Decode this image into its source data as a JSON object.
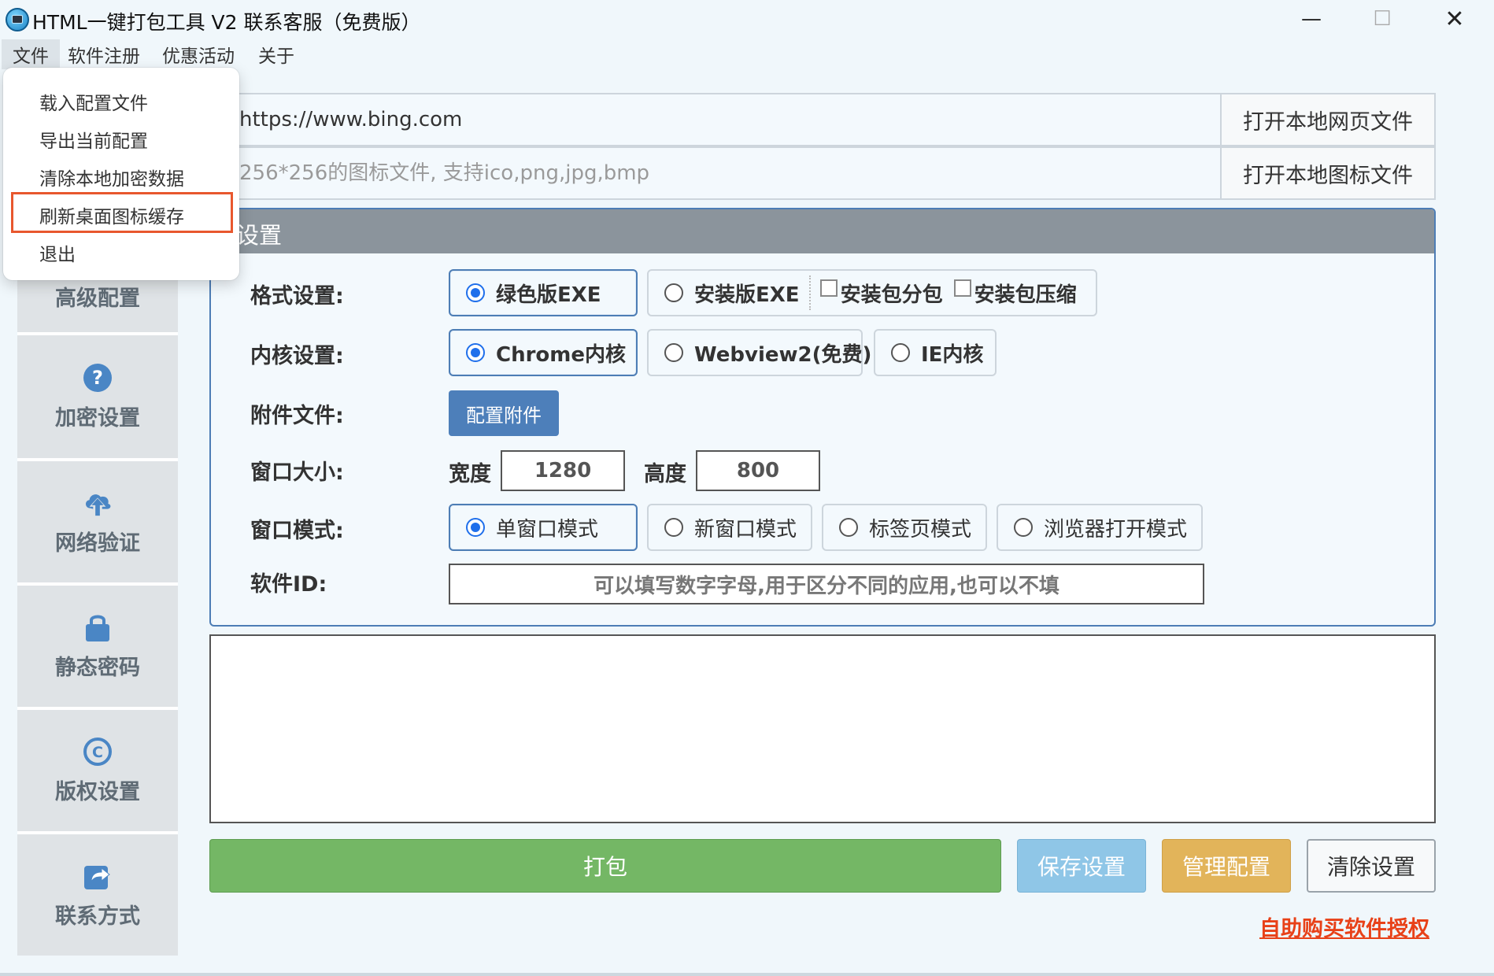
{
  "window": {
    "title": "HTML一键打包工具 V2 联系客服（免费版）",
    "minimize": "—",
    "maximize": "☐",
    "close": "✕"
  },
  "menu": {
    "file": "文件",
    "register": "软件注册",
    "promo": "优惠活动",
    "about": "关于"
  },
  "file_menu": {
    "items": [
      "载入配置文件",
      "导出当前配置",
      "清除本地加密数据",
      "刷新桌面图标缓存",
      "退出"
    ],
    "highlighted": "刷新桌面图标缓存"
  },
  "sidebar": {
    "items": [
      {
        "label": "高级配置",
        "icon": "settings-icon"
      },
      {
        "label": "加密设置",
        "icon": "question-circle-icon"
      },
      {
        "label": "网络验证",
        "icon": "cloud-upload-icon"
      },
      {
        "label": "静态密码",
        "icon": "lock-icon"
      },
      {
        "label": "版权设置",
        "icon": "copyright-icon"
      },
      {
        "label": "联系方式",
        "icon": "share-icon"
      }
    ],
    "icon_color": "#4a86c5"
  },
  "url_row": {
    "value": "https://www.bing.com",
    "button": "打开本地网页文件"
  },
  "icon_row": {
    "placeholder": "256*256的图标文件, 支持ico,png,jpg,bmp",
    "button": "打开本地图标文件"
  },
  "settings": {
    "title": "设置",
    "format": {
      "label": "格式设置:",
      "options": [
        "绿色版EXE",
        "安装版EXE"
      ],
      "selected": "绿色版EXE",
      "checkboxes": [
        "安装包分包",
        "安装包压缩"
      ]
    },
    "kernel": {
      "label": "内核设置:",
      "options": [
        "Chrome内核",
        "Webview2(免费)",
        "IE内核"
      ],
      "selected": "Chrome内核"
    },
    "attachment": {
      "label": "附件文件:",
      "button": "配置附件"
    },
    "window_size": {
      "label": "窗口大小:",
      "width_label": "宽度",
      "width": "1280",
      "height_label": "高度",
      "height": "800"
    },
    "window_mode": {
      "label": "窗口模式:",
      "options": [
        "单窗口模式",
        "新窗口模式",
        "标签页模式",
        "浏览器打开模式"
      ],
      "selected": "单窗口模式"
    },
    "app_id": {
      "label": "软件ID:",
      "placeholder": "可以填写数字字母,用于区分不同的应用,也可以不填"
    }
  },
  "buttons": {
    "pack": "打包",
    "save": "保存设置",
    "manage": "管理配置",
    "clear": "清除设置"
  },
  "buy_link": "自助购买软件授权",
  "colors": {
    "accent": "#4d7db5",
    "pack": "#74b765",
    "save": "#8fc6e7",
    "manage": "#e2b45a",
    "link": "#e84118"
  }
}
